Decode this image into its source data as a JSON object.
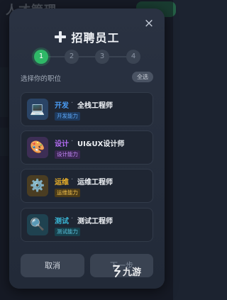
{
  "background": {
    "title": "人才管理"
  },
  "modal": {
    "title": "招聘员工",
    "close_icon": "×",
    "steps": [
      "1",
      "2",
      "3",
      "4"
    ],
    "active_step": 1,
    "section_label": "选择你的职位",
    "select_all": "全选",
    "positions": [
      {
        "category": "开发",
        "role": "全栈工程师",
        "tag": "开发能力",
        "icon": "laptop-icon",
        "glyph": "💻",
        "color": "#4a9df6"
      },
      {
        "category": "设计",
        "role": "UI&UX设计师",
        "tag": "设计能力",
        "icon": "palette-icon",
        "glyph": "🎨",
        "color": "#b36cf3"
      },
      {
        "category": "运维",
        "role": "运维工程师",
        "tag": "运维能力",
        "icon": "gear-icon",
        "glyph": "⚙️",
        "color": "#f0b429"
      },
      {
        "category": "测试",
        "role": "测试工程师",
        "tag": "测试能力",
        "icon": "magnifier-icon",
        "glyph": "🔍",
        "color": "#39b8d8"
      }
    ],
    "cancel_label": "取消",
    "next_label": "下一步"
  },
  "watermark": {
    "text": "九游"
  }
}
